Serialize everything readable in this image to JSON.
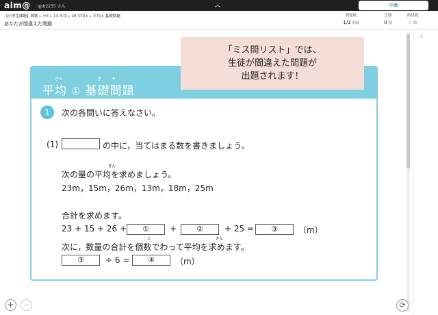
{
  "topbar": {
    "logo": "aim@",
    "user": "qjrb2255 さん",
    "collapse_icon": "chevron-up-icon",
    "pause_label": "中断"
  },
  "header": {
    "breadcrumb": [
      "【小学生課題】算数",
      "小5",
      "13.平均",
      "28.平均①",
      "平均① 基礎問題"
    ],
    "title": "あなたが間違えた問題",
    "stats": {
      "count_label": "問題数",
      "count_value": "1/1",
      "count_unit": "問目",
      "correct_label": "正解",
      "correct_value": "0",
      "correct_unit": "問",
      "retry_label": "再挑戦",
      "retry_value": "0",
      "retry_unit": "問"
    }
  },
  "card": {
    "title_left": "平均",
    "title_num": "①",
    "title_right": "基礎問題",
    "ruby_1": "きん",
    "ruby_2": "き",
    "ruby_3": "そ"
  },
  "question": {
    "number": "1",
    "instruction": "次の各問いに答えなさい。",
    "part_label": "(1)",
    "part_text": "の中に，当てはまる数を書きましょう。",
    "line1": "次の量の平均を求めましょう。",
    "line1_ruby": "きん",
    "data_values": "23m，15m，26m，13m，18m，25m",
    "line2": "合計を求めます。",
    "eq_left": "23 + 15 + 26 +",
    "blank_1": "①",
    "plus": "+",
    "blank_2": "②",
    "eq_mid": "+ 25 =",
    "blank_3": "③",
    "unit_m": "（m）",
    "line3": "次に，数量の合計を個数でわって平均を求めます。",
    "line3_ruby_ko": "こ",
    "line3_ruby_kin": "きん",
    "blank_4": "③",
    "div_text": "÷ 6 =",
    "blank_5": "④",
    "unit_m2": "（m）"
  },
  "callout": {
    "line1": "「ミス問リスト」では、",
    "line2": "生徒が間違えた問題が",
    "line3": "出題されます！"
  },
  "controls": {
    "zoom_in": "+",
    "zoom_out": "−",
    "refresh_icon": "refresh-icon",
    "panel_toggle": "‹"
  }
}
